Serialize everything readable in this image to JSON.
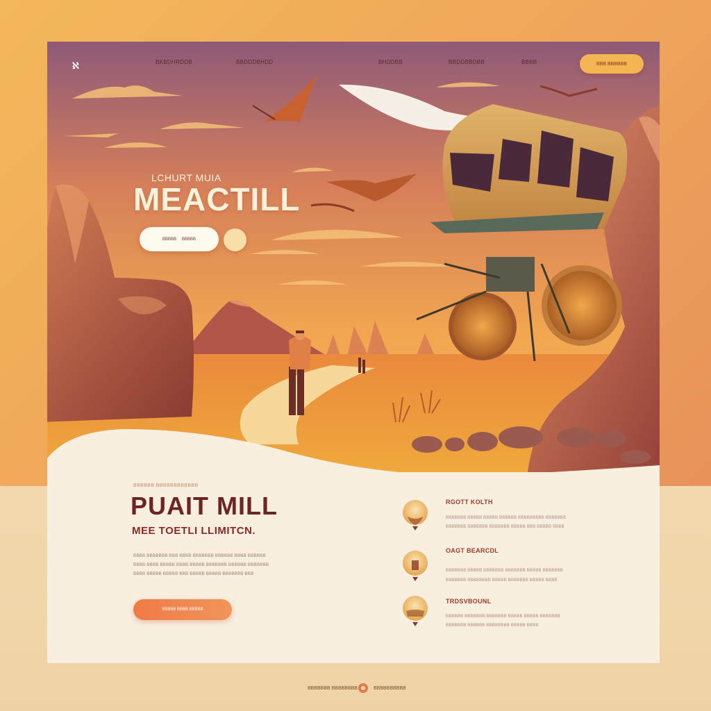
{
  "nav": {
    "logo_glyph": "ℵ",
    "links": [
      "BKBDHRDDB",
      "BBDDDBHDD",
      "BHDDBB",
      "BBDDBBDBB",
      "BBBB"
    ],
    "cta_label": "BBB BBBBBB"
  },
  "hero": {
    "eyebrow": "LCHURT MUIA",
    "title": "MEACTILL",
    "pill_left": "BBBBB",
    "pill_right": "BBBBB"
  },
  "section": {
    "eyebrow": "BBBBBB BBBBBBBBBBBB",
    "title": "PUAIT MILL",
    "subtitle": "MEE TOETLI LLIMITCN.",
    "paragraph_lines": [
      "BBBB BBBBBBB BBB BBBB BBBBBBB BBBBBB BBBB BBBBBB",
      "BBBB BBBB BBBBB BBBB BBBBB BBBBBBB BBBBBB BBBBBBB",
      "BBBB BBBBB BBBBB BBB BBBBB BBBBB BBBBBBB BBB"
    ],
    "cta_label": "BBBBB BBBB BBBBB"
  },
  "features": [
    {
      "title": "RGOTT KOLTH",
      "lines": [
        "BBBBBBB BBBBB BBBBB BBBBBB BBBBBBBBB BBBBBBB",
        "BBBBBBB BBBBBBB BBBBBBB BBBBB BBB BBBBB BBBB"
      ]
    },
    {
      "title": "OAGT BEARCDL",
      "lines": [
        "BBBBBBB BBBBB BBBBBBB BBBBBBB BBBBB BBBBBBB",
        "BBBBBBB BBBBBBBB BBBBB BBBBBBB BBBBB BBBB"
      ]
    },
    {
      "title": "TRDSVBOUNL",
      "lines": [
        "BBBBBB BBBBBBB BBBBBBB BBBBB BBBBB BBBBBBB",
        "BBBBBBB BBBBBB BBBBBBBB BBBBB BBBB"
      ]
    }
  ],
  "footer": {
    "left": "BBBBBBB BBBBBBBB",
    "right": "BBBBBBBBBB"
  },
  "colors": {
    "accent": "#f07a45",
    "title": "#6e2424",
    "sky_top": "#8e5a78",
    "sand": "#f0a33c"
  }
}
